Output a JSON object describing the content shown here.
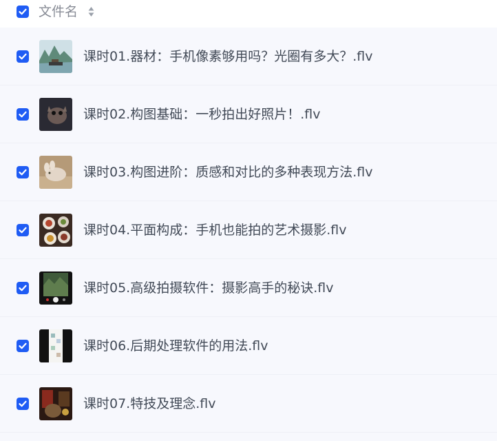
{
  "header": {
    "label": "文件名",
    "select_all_checked": true,
    "sort_icon": "sort-icon",
    "checkbox_color": "#1f5cf4"
  },
  "files": [
    {
      "name": "课时01.器材：手机像素够用吗？光圈有多大？.flv",
      "checked": true,
      "thumbnail": "landscape-boat-photo"
    },
    {
      "name": "课时02.构图基础：一秒拍出好照片！.flv",
      "checked": true,
      "thumbnail": "pet-photo"
    },
    {
      "name": "课时03.构图进阶：质感和对比的多种表现方法.flv",
      "checked": true,
      "thumbnail": "rabbit-photo"
    },
    {
      "name": "课时04.平面构成：手机也能拍的艺术摄影.flv",
      "checked": true,
      "thumbnail": "food-photo"
    },
    {
      "name": "课时05.高级拍摄软件：摄影高手的秘诀.flv",
      "checked": true,
      "thumbnail": "camera-app-screenshot"
    },
    {
      "name": "课时06.后期处理软件的用法.flv",
      "checked": true,
      "thumbnail": "editing-app-screenshot"
    },
    {
      "name": "课时07.特技及理念.flv",
      "checked": true,
      "thumbnail": "night-scene-photo"
    }
  ]
}
